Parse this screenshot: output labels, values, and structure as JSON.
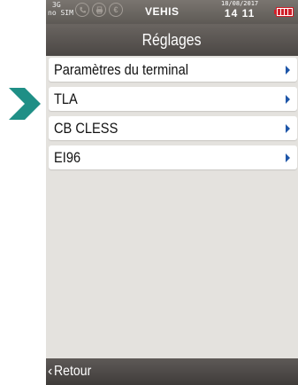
{
  "status_bar": {
    "network": "3G",
    "sim": "no SIM",
    "operator": "VEHIS",
    "date": "18/08/2017",
    "time": "14 11",
    "icons": [
      "phone-icon",
      "printer-icon",
      "euro-icon",
      "battery-icon"
    ]
  },
  "title": "Réglages",
  "menu": {
    "items": [
      {
        "label": "Paramètres du terminal",
        "icon": "chevron-right-icon"
      },
      {
        "label": "TLA",
        "icon": "chevron-right-icon",
        "highlighted_by_pointer": true
      },
      {
        "label": "CB CLESS",
        "icon": "chevron-right-icon"
      },
      {
        "label": "EI96",
        "icon": "chevron-right-icon"
      }
    ]
  },
  "bottom_bar": {
    "back_label": "Retour",
    "back_icon": "chevron-left-icon"
  },
  "colors": {
    "pointer_arrow": "#1f8f86",
    "chevron": "#1d55a8",
    "background": "#e4e2de",
    "battery": "#d0202a"
  }
}
